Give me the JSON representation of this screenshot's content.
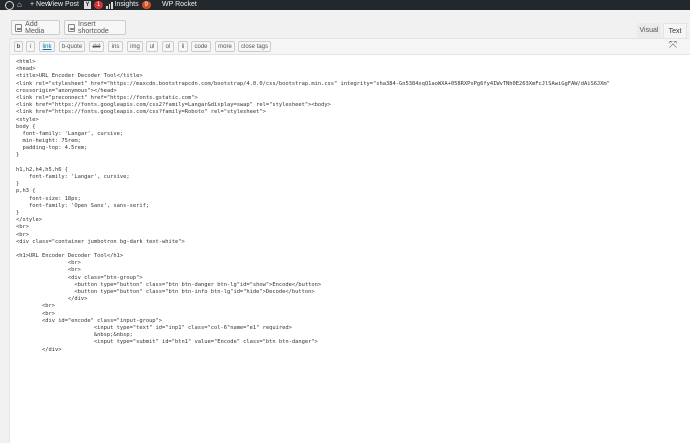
{
  "adminbar": {
    "items": [
      {
        "name": "wp-logo-icon",
        "label": ""
      },
      {
        "name": "my-sites",
        "label": ""
      },
      {
        "name": "site-home",
        "label": ""
      },
      {
        "name": "new",
        "label": "+ New"
      },
      {
        "name": "view-post",
        "label": "View Post"
      },
      {
        "name": "yoast",
        "label": "1"
      },
      {
        "name": "insights",
        "label": "Insights",
        "badge": "9"
      },
      {
        "name": "wp-rocket",
        "label": "WP Rocket"
      }
    ]
  },
  "media_buttons": {
    "add_media": "Add Media",
    "insert_shortcode": "Insert shortcode"
  },
  "tabs": {
    "visual": "Visual",
    "text": "Text"
  },
  "quicktags": [
    "b",
    "i",
    "link",
    "b-quote",
    "del",
    "ins",
    "img",
    "ul",
    "ol",
    "li",
    "code",
    "more",
    "close tags"
  ],
  "code_lines": [
    "<html>",
    "<head>",
    "<title>URL Encoder Decoder Tool</title>",
    "<link rel=\"stylesheet\" href=\"https://maxcdn.bootstrapcdn.com/bootstrap/4.0.0/css/bootstrap.min.css\" integrity=\"sha384-Gn5384xqQ1aoWXA+058RXPxPg6fy4IWvTNh0E263XmFcJlSAwiGgFAW/dAiS6JXm\"",
    "crossorigin=\"anonymous\"></head>",
    "<link rel=\"preconnect\" href=\"https://fonts.gstatic.com\">",
    "<link href=\"https://fonts.googleapis.com/css2?family=Langar&display=swap\" rel=\"stylesheet\"><body>",
    "<link href=\"https://fonts.googleapis.com/css?family=Roboto\" rel=\"stylesheet\">",
    "<style>",
    "body {",
    "  font-family: 'Langar', cursive;",
    "  min-height: 75rem;",
    "  padding-top: 4.5rem;",
    "}",
    "",
    "h1,h2,h4,h5,h6 {",
    "    font-family: 'Langar', cursive;",
    "}",
    "p,h3 {",
    "    font-size: 18px;",
    "    font-family: 'Open Sans', sans-serif;",
    "}",
    "</style>",
    "<br>",
    "<br>",
    "<div class=\"container jumbotron bg-dark text-white\">",
    "",
    "<h1>URL Encoder Decoder Tool</h1>",
    "                <br>",
    "                <br>",
    "                <div class=\"btn-group\">",
    "                  <button type=\"button\" class=\"btn btn-danger btn-lg\"id=\"show\">Encode</button>",
    "                  <button type=\"button\" class=\"btn btn-info btn-lg\"id=\"hide\">Decode</button>",
    "                </div>",
    "        <br>",
    "        <br>",
    "        <div id=\"encode\" class=\"input-group\">",
    "                        <input type=\"text\" id=\"inp1\" class=\"col-6\"name=\"e1\" required>",
    "                        &nbsp;&nbsp;",
    "                        <input type=\"submit\" id=\"btn1\" value=\"Encode\" class=\"btn btn-danger\">",
    "        </div>"
  ]
}
